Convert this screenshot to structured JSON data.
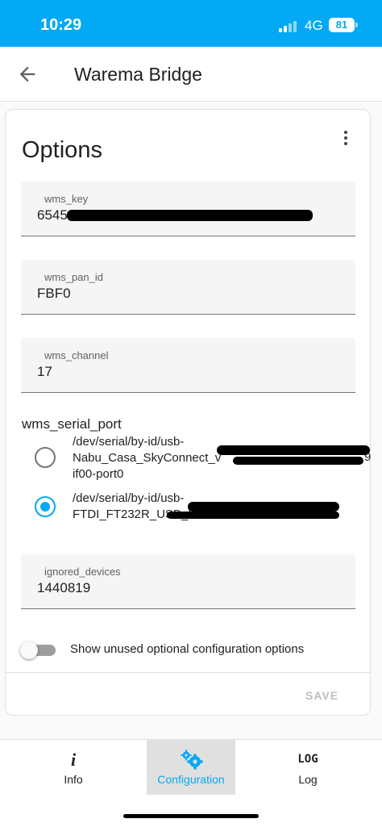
{
  "status_bar": {
    "time": "10:29",
    "network": "4G",
    "battery": "81",
    "accent_color": "#03a9f4"
  },
  "app_bar": {
    "title": "Warema Bridge",
    "back_icon": "arrow-left-icon"
  },
  "card": {
    "title": "Options",
    "menu_icon": "more-vert-icon",
    "fields": [
      {
        "label": "wms_key",
        "value": "6545C"
      },
      {
        "label": "wms_pan_id",
        "value": "FBF0"
      },
      {
        "label": "wms_channel",
        "value": "17"
      }
    ],
    "serial_port": {
      "label": "wms_serial_port",
      "options": [
        {
          "line1": "/dev/serial/by-id/usb-",
          "line2": "Nabu_Casa_SkyConnect_v",
          "line3": "if00-port0",
          "suffix": "98",
          "selected": false
        },
        {
          "line1": "/dev/serial/by-id/usb-",
          "line2": "FTDI_FT232R_USB_U",
          "line3": "",
          "suffix": "",
          "selected": true
        }
      ]
    },
    "ignored_devices": {
      "label": "ignored_devices",
      "value": "1440819"
    },
    "toggle": {
      "label": "Show unused optional configuration options",
      "on": false
    },
    "save_label": "SAVE"
  },
  "tabs": [
    {
      "icon": "i",
      "icon_name": "info-icon",
      "label": "Info",
      "active": false
    },
    {
      "icon": "",
      "icon_name": "cogs-icon",
      "label": "Configuration",
      "active": true
    },
    {
      "icon": "LOG",
      "icon_name": "log-icon",
      "label": "Log",
      "active": false
    }
  ]
}
